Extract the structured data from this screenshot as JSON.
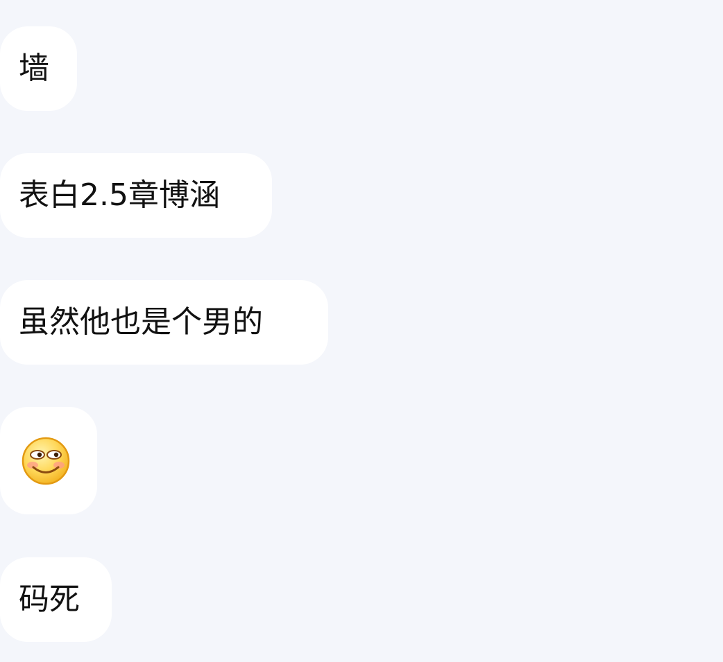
{
  "messages": [
    {
      "type": "text",
      "text": "墙"
    },
    {
      "type": "text",
      "text": "表白2.5章博涵"
    },
    {
      "type": "text",
      "text": "虽然他也是个男的"
    },
    {
      "type": "emoji",
      "icon": "shy-smile-emoji"
    },
    {
      "type": "text",
      "text": "码死"
    }
  ],
  "colors": {
    "background": "#f4f6fb",
    "bubble": "#ffffff",
    "text": "#111111"
  }
}
